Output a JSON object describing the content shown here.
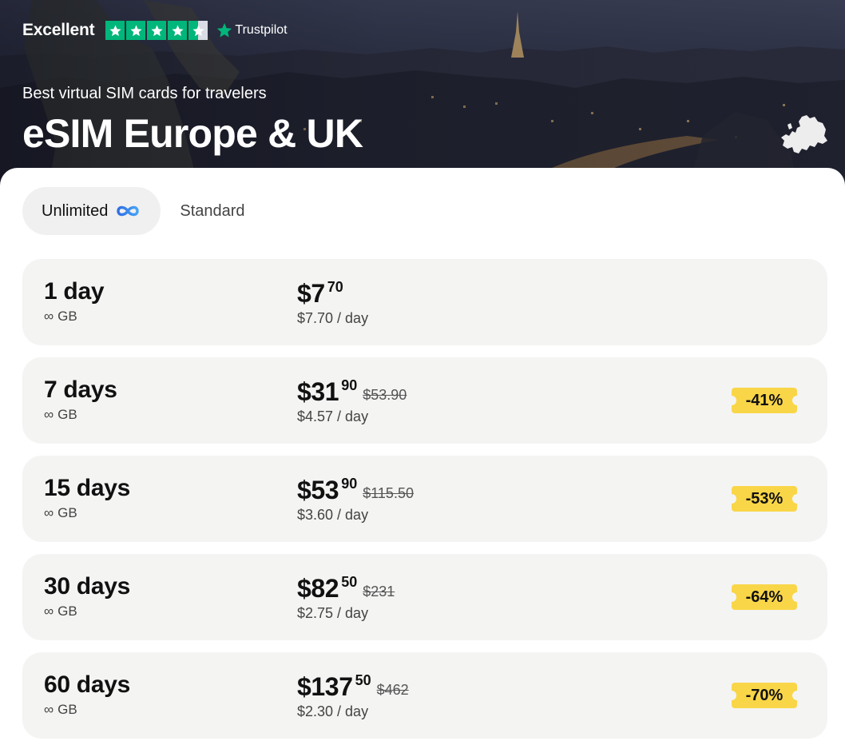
{
  "trustpilot": {
    "rating_label": "Excellent",
    "stars": 4.5,
    "brand": "Trustpilot"
  },
  "hero": {
    "subtitle": "Best virtual SIM cards for travelers",
    "title": "eSIM Europe & UK",
    "map_icon": "europe-map-icon"
  },
  "tabs": [
    {
      "label": "Unlimited",
      "active": true,
      "icon": "infinity-icon"
    },
    {
      "label": "Standard",
      "active": false
    }
  ],
  "plans": [
    {
      "duration": "1 day",
      "data": "GB",
      "price_whole": "$7",
      "price_cents": "70",
      "old_price": "",
      "per_day": "$7.70 / day",
      "discount": ""
    },
    {
      "duration": "7 days",
      "data": "GB",
      "price_whole": "$31",
      "price_cents": "90",
      "old_price": "$53.90",
      "per_day": "$4.57 / day",
      "discount": "-41%"
    },
    {
      "duration": "15 days",
      "data": "GB",
      "price_whole": "$53",
      "price_cents": "90",
      "old_price": "$115.50",
      "per_day": "$3.60 / day",
      "discount": "-53%"
    },
    {
      "duration": "30 days",
      "data": "GB",
      "price_whole": "$82",
      "price_cents": "50",
      "old_price": "$231",
      "per_day": "$2.75 / day",
      "discount": "-64%"
    },
    {
      "duration": "60 days",
      "data": "GB",
      "price_whole": "$137",
      "price_cents": "50",
      "old_price": "$462",
      "per_day": "$2.30 / day",
      "discount": "-70%"
    }
  ],
  "colors": {
    "trustpilot_green": "#00b67a",
    "discount_badge": "#f9d648",
    "card_background": "#f4f4f3",
    "active_tab": "#f0f0f0",
    "infinity_accent": "#2f6fe4"
  }
}
